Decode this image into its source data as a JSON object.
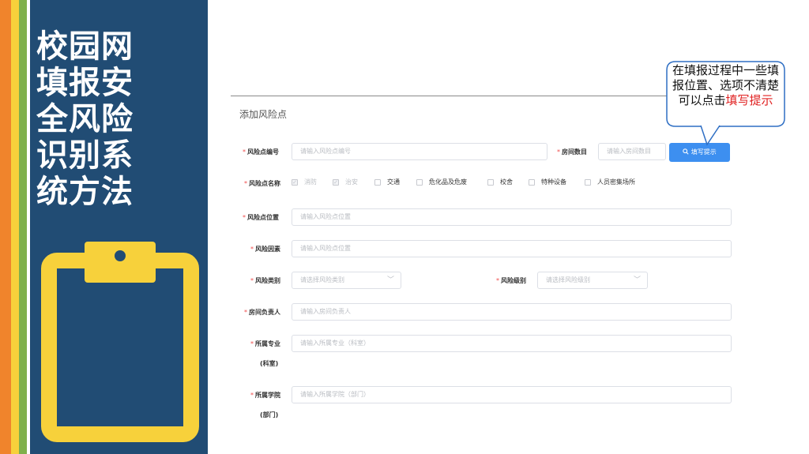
{
  "slide_title": {
    "lines": [
      "校园网",
      "填报安",
      "全风险",
      "识别系",
      "统方法"
    ]
  },
  "form": {
    "section_title": "添加风险点",
    "required_mark": "*",
    "risk_code": {
      "label": "风险点编号",
      "placeholder": "请输入风险点编号"
    },
    "room_count": {
      "label": "房间数目",
      "placeholder": "请输入房间数目"
    },
    "hint_button": {
      "label": "填写提示",
      "icon": "search-icon"
    },
    "risk_name": {
      "label": "风险点名称",
      "options": [
        {
          "label": "消防",
          "checked": true,
          "disabled": true
        },
        {
          "label": "治安",
          "checked": true,
          "disabled": true
        },
        {
          "label": "交通",
          "checked": false,
          "disabled": false
        },
        {
          "label": "危化品及危废",
          "checked": false,
          "disabled": false
        },
        {
          "label": "校舍",
          "checked": false,
          "disabled": false
        },
        {
          "label": "特种设备",
          "checked": false,
          "disabled": false
        },
        {
          "label": "人员密集场所",
          "checked": false,
          "disabled": false
        }
      ]
    },
    "risk_location": {
      "label": "风险点位置",
      "placeholder": "请输入风险点位置"
    },
    "risk_factor": {
      "label": "风险因素",
      "placeholder": "请输入风险点位置"
    },
    "risk_category": {
      "label": "风险类别",
      "placeholder": "请选择风险类别"
    },
    "risk_level": {
      "label": "风险级别",
      "placeholder": "请选择风险级别"
    },
    "room_owner": {
      "label": "房间负责人",
      "placeholder": "请输入房间负责人"
    },
    "major": {
      "label": "所属专业",
      "label_sub": "(科室)",
      "placeholder": "请输入所属专业（科室）"
    },
    "college": {
      "label": "所属学院",
      "label_sub": "(部门)",
      "placeholder": "请输入所属学院（部门）"
    }
  },
  "callout": {
    "text_before": "在填报过程中一些填报位置、选项不清楚可以点击",
    "text_highlight": "填写提示"
  },
  "colors": {
    "panel": "#214c74",
    "accent_button": "#3d8ff0",
    "clipboard": "#f7d13b",
    "callout_border": "#2f6fc4",
    "highlight": "#e02020"
  }
}
